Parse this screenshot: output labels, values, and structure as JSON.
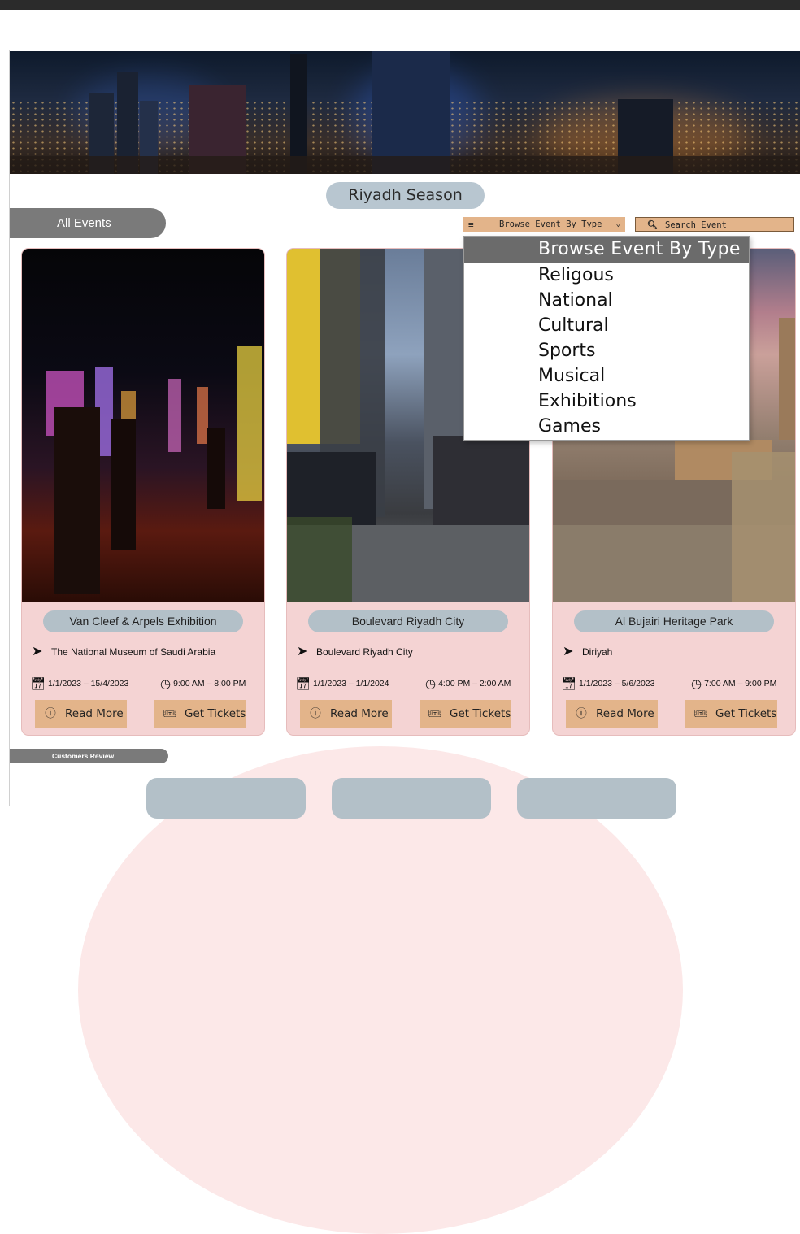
{
  "header": {
    "site_title": "Riyadh Season",
    "all_events_label": "All Events"
  },
  "filters": {
    "browse_label": "Browse Event By Type",
    "search_placeholder": "Search Event",
    "browse_options": [
      "Browse Event By Type",
      "Religous",
      "National",
      "Cultural",
      "Sports",
      "Musical",
      "Exhibitions",
      "Games"
    ]
  },
  "events": [
    {
      "name": "Van Cleef & Arpels Exhibition",
      "location": "The National Museum of Saudi Arabia",
      "dates": "1/1/2023 – 15/4/2023",
      "time": "9:00 AM – 8:00 PM",
      "read_more": "Read More",
      "get_tickets": "Get Tickets"
    },
    {
      "name": "Boulevard Riyadh City",
      "location": "Boulevard Riyadh City",
      "dates": "1/1/2023 – 1/1/2024",
      "time": "4:00 PM – 2:00 AM",
      "read_more": "Read More",
      "get_tickets": "Get Tickets"
    },
    {
      "name": "Al Bujairi Heritage Park",
      "location": "Diriyah",
      "dates": "1/1/2023 – 5/6/2023",
      "time": "7:00 AM – 9:00 PM",
      "read_more": "Read More",
      "get_tickets": "Get Tickets"
    }
  ],
  "reviews": {
    "label": "Customers Review"
  },
  "colors": {
    "accent_tan": "#e3b48a",
    "card_pink": "#f4d3d3",
    "pill_blue_gray": "#b3c0c8",
    "tab_gray": "#7a7a7a"
  },
  "icons": {
    "location": "navigation-arrow-icon",
    "date": "calendar-check-icon",
    "time": "clock-icon",
    "read_more": "info-circle-icon",
    "get_tickets": "ticket-icon",
    "search": "magnifier-icon",
    "browse": "list-icon"
  }
}
